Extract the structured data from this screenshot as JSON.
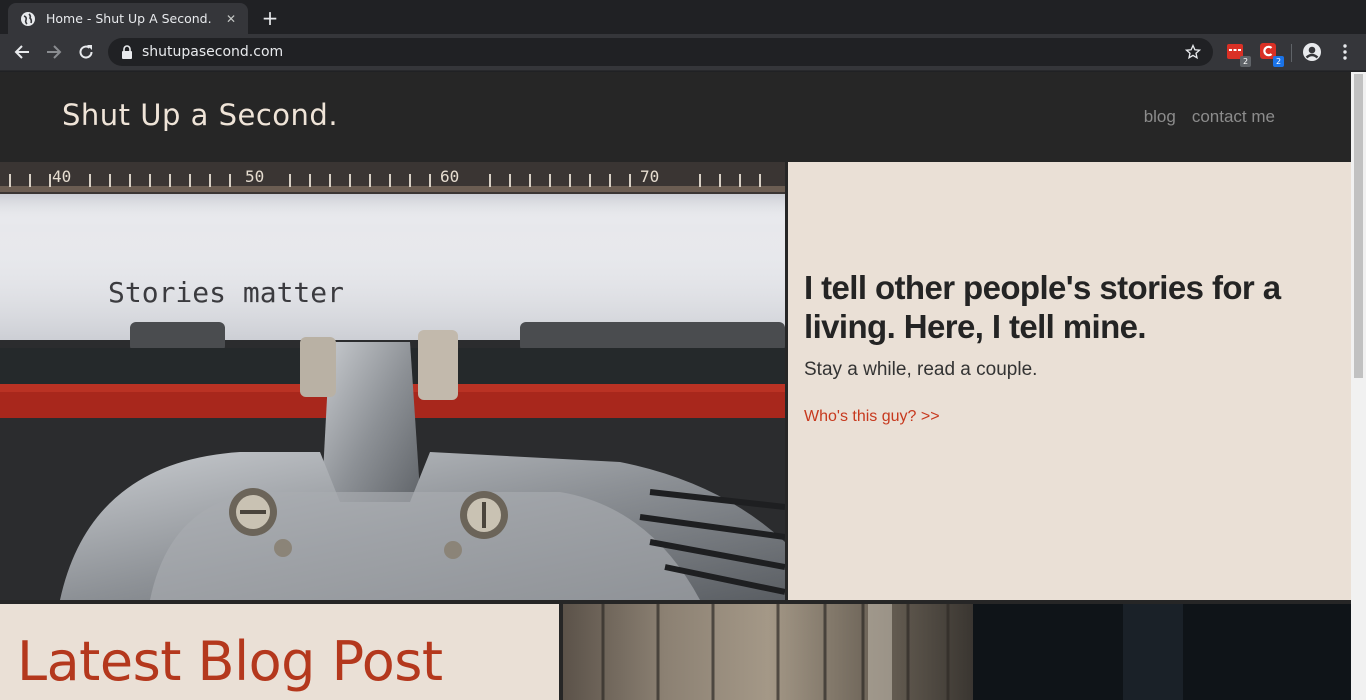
{
  "browser": {
    "tab_title": "Home - Shut Up A Second.",
    "url": "shutupasecond.com",
    "extensions": [
      {
        "name": "calendar-extension",
        "badge": "2",
        "badge_color": "#5f6368",
        "color": "#d93025"
      },
      {
        "name": "c-extension",
        "badge": "2",
        "badge_color": "#1a73e8",
        "color": "#d93025"
      }
    ]
  },
  "site": {
    "logo": "Shut Up a Second.",
    "nav": [
      "blog",
      "contact me"
    ]
  },
  "hero": {
    "image_text": "Stories matter",
    "heading": "I tell other people's stories for a living. Here, I tell mine.",
    "subheading": "Stay a while, read a couple.",
    "link": "Who's this guy? >>"
  },
  "latest": {
    "title": "Latest Blog Post"
  },
  "colors": {
    "accent": "#c7391e",
    "panel": "#eae0d6",
    "dark": "#262626"
  }
}
